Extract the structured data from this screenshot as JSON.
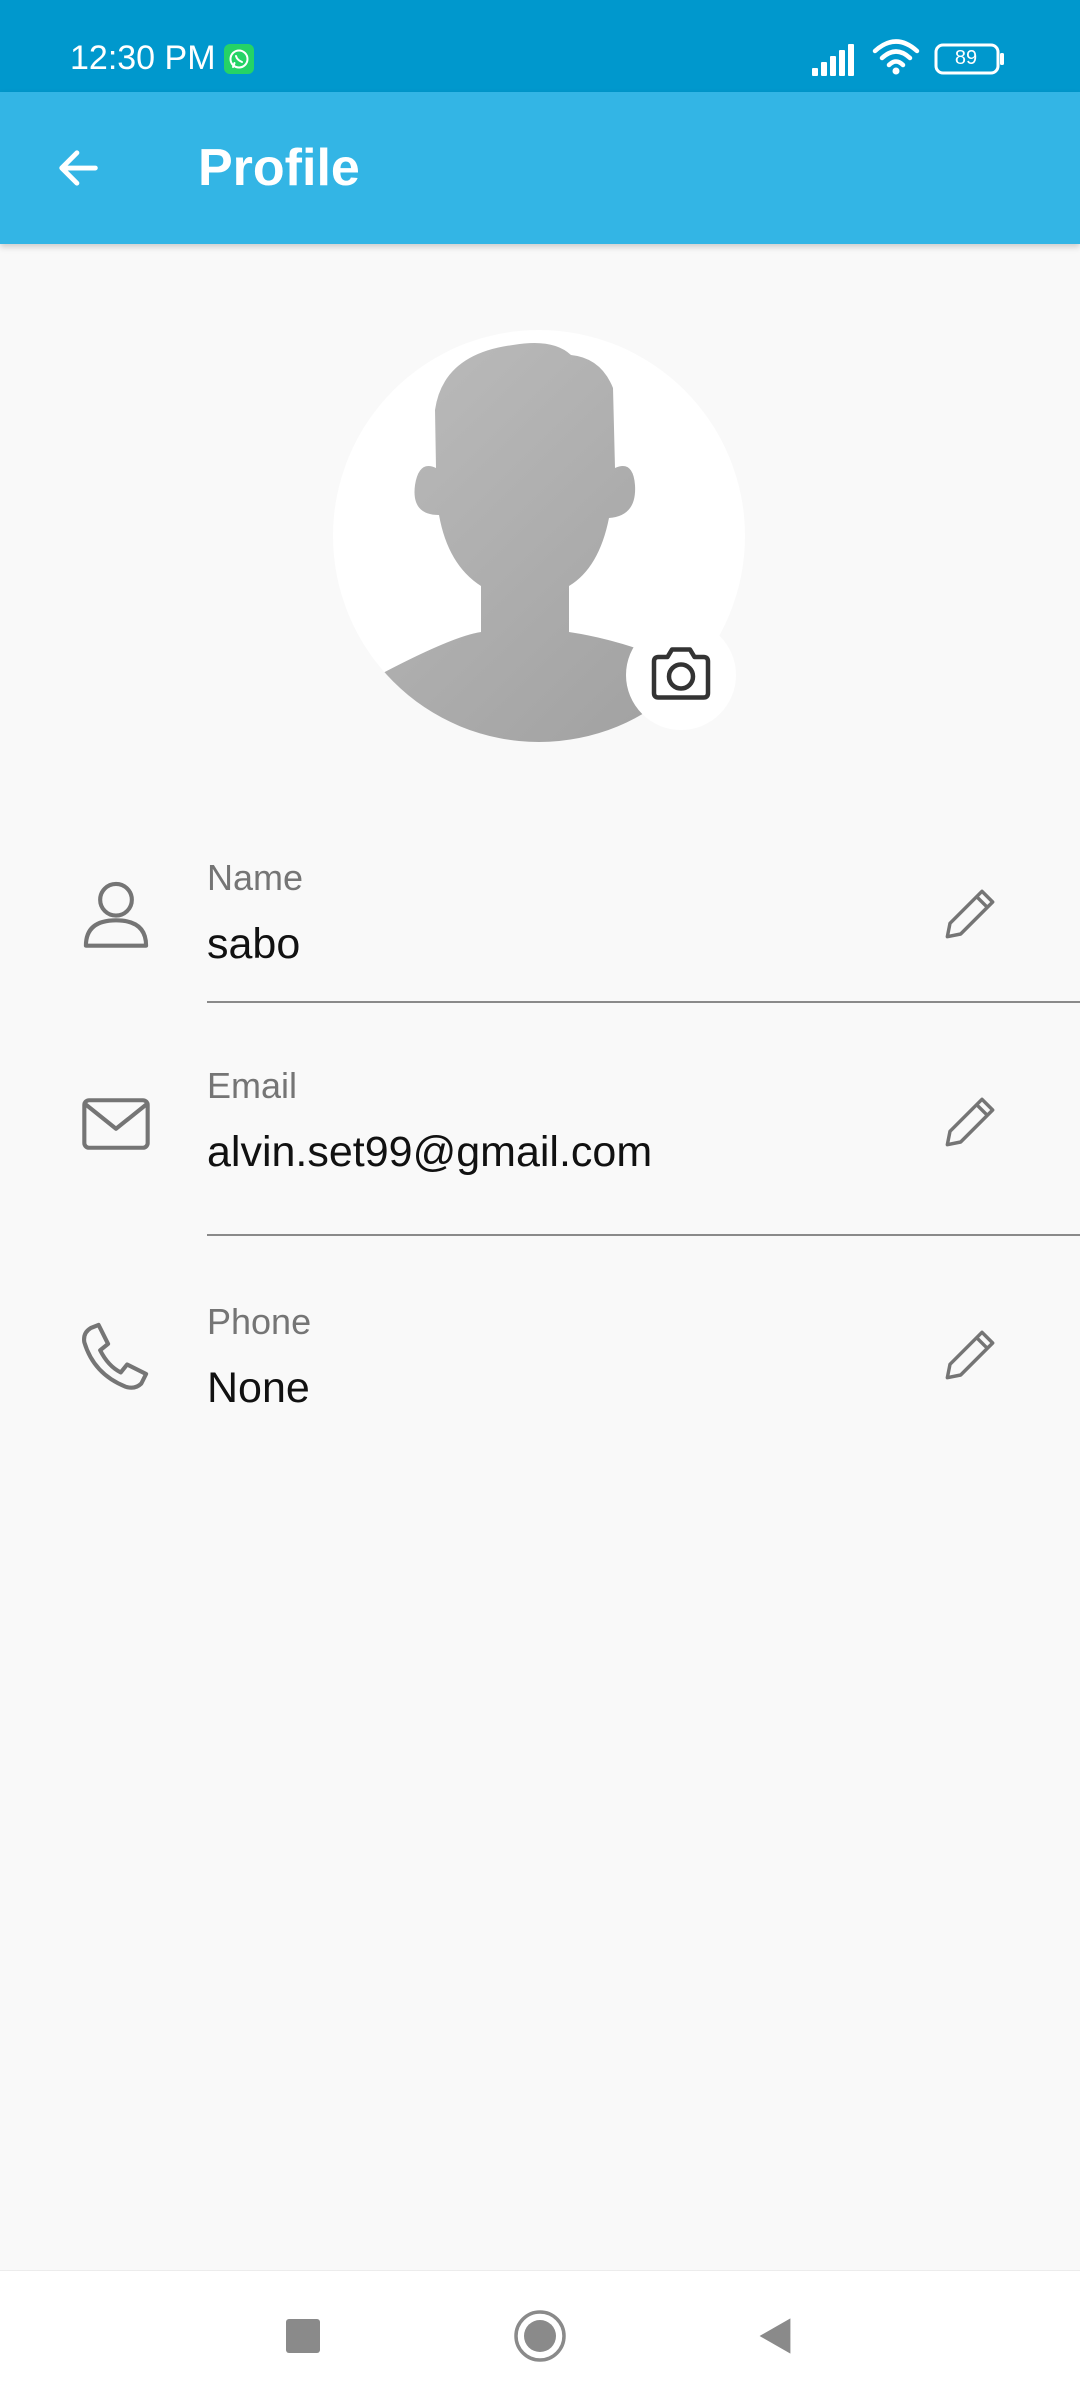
{
  "status_bar": {
    "time": "12:30 PM",
    "battery": "89",
    "icons": [
      "whatsapp-icon",
      "signal-icon",
      "wifi-icon",
      "battery-icon"
    ]
  },
  "app_bar": {
    "title": "Profile",
    "back_icon": "arrow-left-icon"
  },
  "avatar": {
    "icon": "person-silhouette",
    "camera_icon": "camera-icon"
  },
  "fields": [
    {
      "label": "Name",
      "value": "sabo",
      "icon": "person-icon",
      "edit_icon": "pencil-icon"
    },
    {
      "label": "Email",
      "value": "alvin.set99@gmail.com",
      "icon": "mail-icon",
      "edit_icon": "pencil-icon"
    },
    {
      "label": "Phone",
      "value": "None",
      "icon": "phone-icon",
      "edit_icon": "pencil-icon"
    }
  ],
  "nav_bar": {
    "buttons": [
      "recents-square-icon",
      "home-circle-icon",
      "back-triangle-icon"
    ]
  },
  "colors": {
    "status_bar": "#0098cd",
    "app_bar": "#33b5e5",
    "background": "#f9f9f9",
    "label": "#757575",
    "value": "#111111",
    "icon": "#757575"
  }
}
